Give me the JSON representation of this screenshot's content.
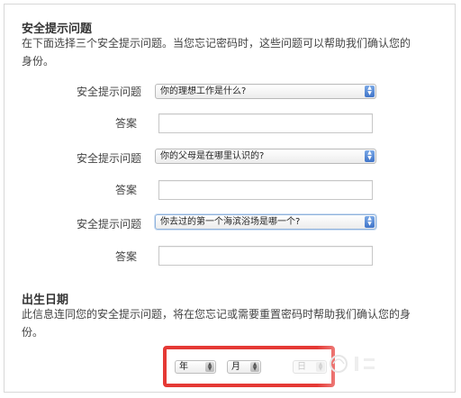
{
  "security": {
    "title": "安全提示问题",
    "description": "在下面选择三个安全提示问题。当您忘记密码时，这些问题可以帮助我们确认您的身份。",
    "rows": [
      {
        "label": "安全提示问题",
        "selected": "你的理想工作是什么?",
        "answer_label": "答案",
        "answer": ""
      },
      {
        "label": "安全提示问题",
        "selected": "你的父母是在哪里认识的?",
        "answer_label": "答案",
        "answer": ""
      },
      {
        "label": "安全提示问题",
        "selected": "你去过的第一个海滨浴场是哪一个?",
        "answer_label": "答案",
        "answer": ""
      }
    ]
  },
  "birth": {
    "title": "出生日期",
    "description": "此信息连同您的安全提示问题，将在您忘记或需要重置密码时帮助我们确认您的身份。",
    "year": "年",
    "month": "月",
    "day": "日"
  },
  "colors": {
    "highlight_border": "#e53935",
    "stepper_blue": "#3f74c9"
  }
}
